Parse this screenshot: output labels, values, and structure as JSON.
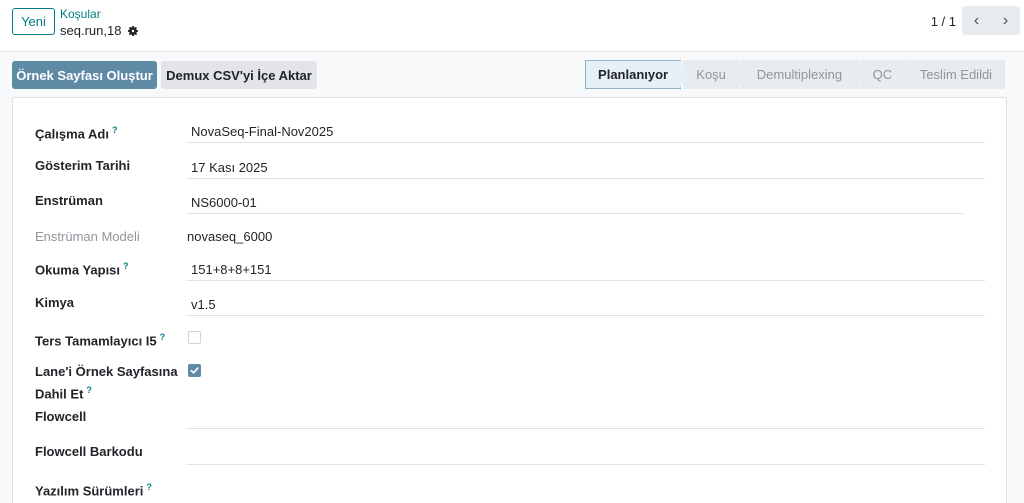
{
  "control_panel": {
    "new_button": "Yeni",
    "breadcrumb_parent": "Koşular",
    "record_name": "seq.run,18",
    "pager": "1 / 1"
  },
  "actions": {
    "create_sample_sheet": "Örnek Sayfası Oluştur",
    "import_demux_csv": "Demux CSV'yi İçe Aktar"
  },
  "statusbar": {
    "stages": [
      {
        "label": "Planlanıyor",
        "active": true
      },
      {
        "label": "Koşu",
        "active": false
      },
      {
        "label": "Demultiplexing",
        "active": false
      },
      {
        "label": "QC",
        "active": false
      },
      {
        "label": "Teslim Edildi",
        "active": false
      }
    ]
  },
  "form": {
    "run_name": {
      "label": "Çalışma Adı",
      "help": "?",
      "value": "NovaSeq-Final-Nov2025"
    },
    "display_date": {
      "label": "Gösterim Tarihi",
      "value": "17 Kası 2025"
    },
    "instrument": {
      "label": "Enstrüman",
      "value": "NS6000-01"
    },
    "instrument_model": {
      "label": "Enstrüman Modeli",
      "value": "novaseq_6000"
    },
    "read_structure": {
      "label": "Okuma Yapısı",
      "help": "?",
      "value": "151+8+8+151"
    },
    "chemistry": {
      "label": "Kimya",
      "value": "v1.5"
    },
    "reverse_complement_i5": {
      "label": "Ters Tamamlayıcı I5",
      "help": "?",
      "checked": false
    },
    "include_lane": {
      "label_line1": "Lane'i Örnek Sayfasına",
      "label_line2": "Dahil Et",
      "help": "?",
      "checked": true
    },
    "flowcell": {
      "label": "Flowcell",
      "value": ""
    },
    "flowcell_barcode": {
      "label": "Flowcell Barkodu",
      "value": ""
    },
    "software_versions": {
      "label": "Yazılım Sürümleri",
      "help": "?"
    }
  },
  "colors": {
    "accent": "#017e84",
    "primary_button": "#5f8aa6",
    "active_stage": "#e6f0f6"
  }
}
